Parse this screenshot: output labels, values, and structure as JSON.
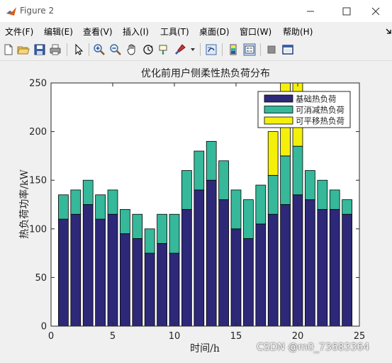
{
  "window": {
    "title": "Figure 2",
    "minimize_icon": "minimize-icon",
    "maximize_icon": "maximize-icon",
    "close_icon": "close-icon"
  },
  "menu": {
    "items": [
      "文件(F)",
      "编辑(E)",
      "查看(V)",
      "插入(I)",
      "工具(T)",
      "桌面(D)",
      "窗口(W)",
      "帮助(H)"
    ],
    "dock_icon": "dock-arrow-icon"
  },
  "toolbar": {
    "icons": [
      "new-figure-icon",
      "open-file-icon",
      "save-icon",
      "print-icon",
      "edit-plot-arrow-icon",
      "zoom-in-icon",
      "zoom-out-icon",
      "pan-hand-icon",
      "rotate-3d-icon",
      "data-cursor-icon",
      "brush-icon",
      "brush-dropdown-icon",
      "link-plot-icon",
      "insert-colorbar-icon",
      "insert-legend-icon",
      "hide-plot-tools-icon",
      "show-plot-tools-icon"
    ]
  },
  "chart_data": {
    "type": "bar",
    "stacked": true,
    "title": "优化前用户侧柔性热负荷分布",
    "xlabel": "时间/h",
    "ylabel": "热负荷功率/kW",
    "xlim": [
      0,
      25
    ],
    "ylim": [
      0,
      250
    ],
    "xticks": [
      0,
      5,
      10,
      15,
      20,
      25
    ],
    "yticks": [
      0,
      50,
      100,
      150,
      200,
      250
    ],
    "x": [
      1,
      2,
      3,
      4,
      5,
      6,
      7,
      8,
      9,
      10,
      11,
      12,
      13,
      14,
      15,
      16,
      17,
      18,
      19,
      20,
      21,
      22,
      23,
      24
    ],
    "series": [
      {
        "name": "基础热负荷",
        "color": "#2e2878",
        "values": [
          110,
          115,
          125,
          110,
          115,
          95,
          90,
          75,
          85,
          75,
          120,
          140,
          150,
          130,
          100,
          90,
          105,
          115,
          125,
          135,
          130,
          120,
          120,
          115
        ]
      },
      {
        "name": "可消减热负荷",
        "color": "#36b89a",
        "values": [
          25,
          25,
          25,
          25,
          25,
          25,
          25,
          25,
          30,
          40,
          40,
          40,
          40,
          40,
          40,
          40,
          40,
          40,
          50,
          50,
          30,
          30,
          20,
          15
        ]
      },
      {
        "name": "可平移热负荷",
        "color": "#f5f00a",
        "values": [
          0,
          0,
          0,
          0,
          0,
          0,
          0,
          0,
          0,
          0,
          0,
          0,
          0,
          0,
          0,
          0,
          0,
          45,
          75,
          65,
          0,
          0,
          0,
          0
        ]
      }
    ],
    "legend_position": "top-right",
    "grid": false
  },
  "watermark": "CSDN @m0_73683364"
}
